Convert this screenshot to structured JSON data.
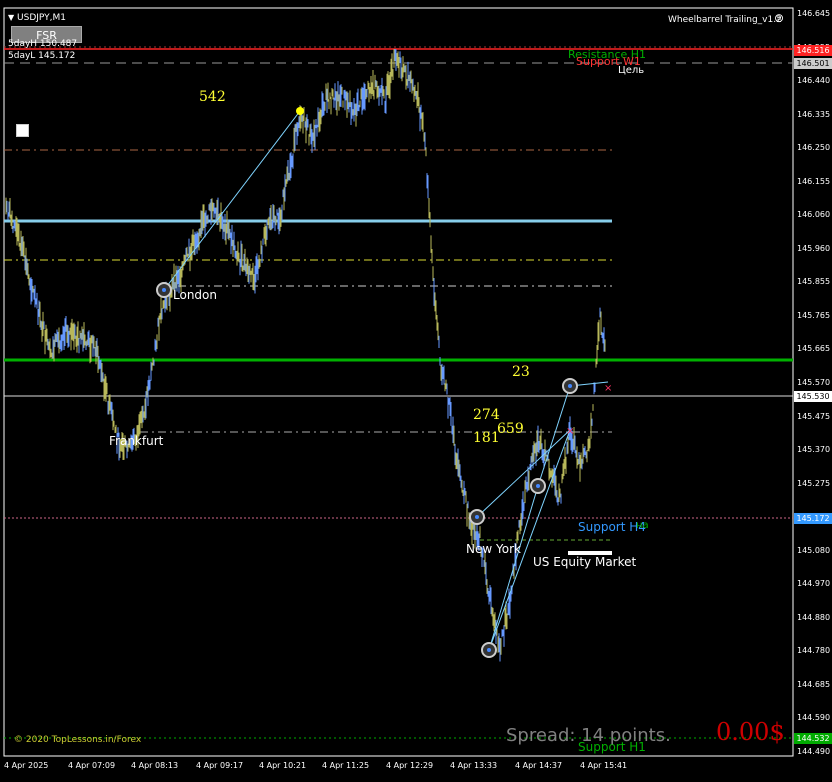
{
  "window": {
    "symbol_label": "USDJPY,M1",
    "indicator_name": "Wheelbarrel Trailing_v1.2",
    "fsr_button": "FSR",
    "stat_high": "5dayH 150.487",
    "stat_low": "5dayL 145.172",
    "copyright": "© 2020 TopLessons.in/Forex",
    "spread_text": "Spread: 14 points.",
    "profit_text": "0.00$"
  },
  "colors": {
    "background": "#000000",
    "axis": "#ffffff",
    "candle_up": "#6699ff",
    "candle_down": "#b8b85a",
    "resistance": "#ff3333",
    "support_green": "#00b000",
    "support_blue": "#3399ff",
    "yellow_text": "#ffff33",
    "profit_red": "#cc0000",
    "spread_gray": "#808080"
  },
  "levels": {
    "resistance_h1": "Resistance H1",
    "support_w1": "Support W1",
    "target": "Цель",
    "support_h4": "Support H4",
    "support_h1": "Support H1",
    "obscured_label": "на"
  },
  "sessions": [
    {
      "name": "London",
      "key": "london"
    },
    {
      "name": "Frankfurt",
      "key": "frankfurt"
    },
    {
      "name": "New York",
      "key": "new-york"
    },
    {
      "name": "US Equity Market",
      "key": "us-equity"
    }
  ],
  "counts": [
    {
      "value": "542",
      "key": "542"
    },
    {
      "value": "23",
      "key": "23"
    },
    {
      "value": "274",
      "key": "274"
    },
    {
      "value": "181",
      "key": "181"
    },
    {
      "value": "659",
      "key": "659"
    }
  ],
  "price_axis": {
    "ticks": [
      "146.645",
      "146.555",
      "146.440",
      "146.335",
      "146.250",
      "146.155",
      "146.060",
      "145.960",
      "145.855",
      "145.765",
      "145.665",
      "145.570",
      "145.475",
      "145.370",
      "145.275",
      "145.170",
      "145.080",
      "144.970",
      "144.880",
      "144.780",
      "144.685",
      "144.590",
      "144.490"
    ],
    "current_price": "145.530",
    "resistance_box": "146.516",
    "support_w1_box": "146.501",
    "support_h4_box": "145.172",
    "support_h1_box": "144.532"
  },
  "time_axis": {
    "ticks": [
      "4 Apr 2025",
      "4 Apr 07:09",
      "4 Apr 08:13",
      "4 Apr 09:17",
      "4 Apr 10:21",
      "4 Apr 11:25",
      "4 Apr 12:29",
      "4 Apr 13:33",
      "4 Apr 14:37",
      "4 Apr 15:41"
    ]
  }
}
